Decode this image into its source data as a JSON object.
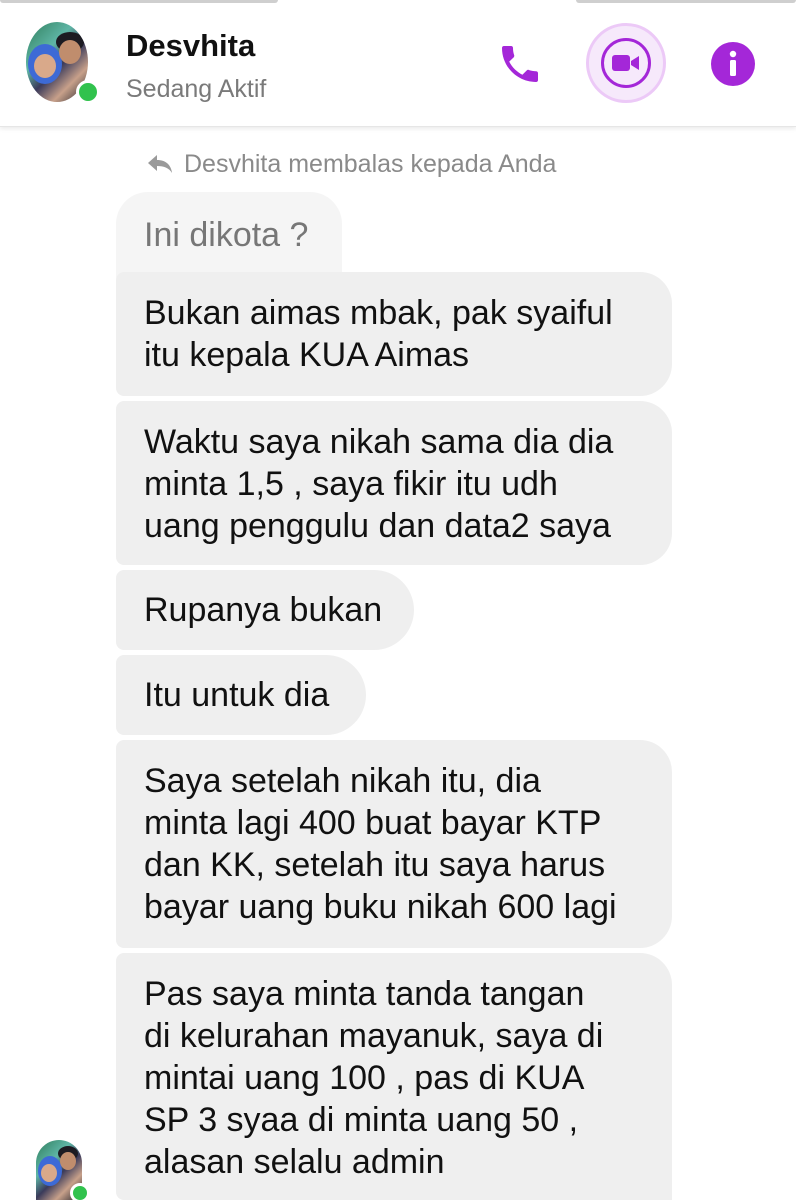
{
  "header": {
    "contact_name": "Desvhita",
    "status": "Sedang Aktif",
    "icons": [
      "phone-icon",
      "video-call-icon",
      "info-icon"
    ],
    "accent_color": "#a427d8",
    "online_color": "#31c24d"
  },
  "conversation": {
    "reply_note": "Desvhita membalas kepada Anda",
    "quoted_message": "Ini dikota ?",
    "messages": [
      "Bukan aimas mbak, pak syaiful\nitu kepala KUA Aimas",
      "Waktu saya nikah sama dia dia\nminta 1,5 , saya fikir itu udh\nuang penggulu dan data2 saya",
      "Rupanya bukan",
      "Itu untuk dia",
      "Saya setelah nikah itu, dia\nminta lagi 400 buat bayar KTP\ndan KK, setelah itu saya harus\nbayar uang buku nikah 600 lagi",
      "Pas saya minta tanda tangan\ndi kelurahan mayanuk, saya di\nmintai uang 100 , pas di KUA\nSP 3 syaa di minta uang 50 ,\nalasan selalu admin"
    ]
  }
}
